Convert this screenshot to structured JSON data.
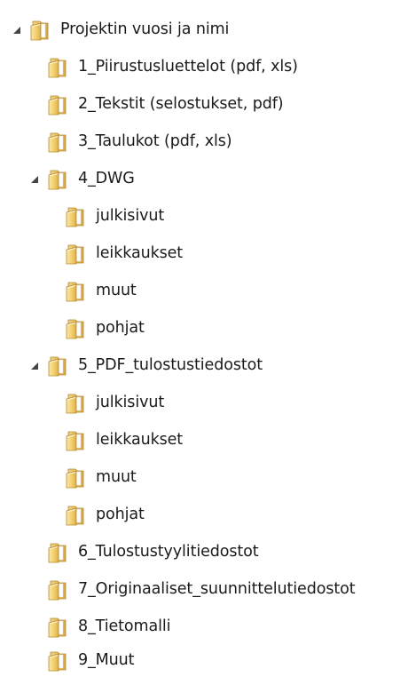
{
  "tree": {
    "root": {
      "label": "Projektin vuosi ja nimi",
      "icon": "folder-icon",
      "expanded": true
    },
    "level1": [
      {
        "label": "1_Piirustusluettelot (pdf, xls)",
        "icon": "folder-icon"
      },
      {
        "label": "2_Tekstit (selostukset, pdf)",
        "icon": "folder-icon"
      },
      {
        "label": "3_Taulukot (pdf, xls)",
        "icon": "folder-icon"
      },
      {
        "label": "4_DWG",
        "icon": "folder-icon",
        "expanded": true
      },
      {
        "label": "5_PDF_tulostustiedostot",
        "icon": "folder-icon",
        "expanded": true
      },
      {
        "label": "6_Tulostustyylitiedostot",
        "icon": "folder-icon"
      },
      {
        "label": "7_Originaaliset_suunnittelutiedostot",
        "icon": "folder-icon"
      },
      {
        "label": "8_Tietomalli",
        "icon": "folder-icon"
      },
      {
        "label": "9_Muut",
        "icon": "folder-icon"
      }
    ],
    "dwg_children": [
      {
        "label": "julkisivut",
        "icon": "folder-icon"
      },
      {
        "label": "leikkaukset",
        "icon": "folder-icon"
      },
      {
        "label": "muut",
        "icon": "folder-icon"
      },
      {
        "label": "pohjat",
        "icon": "folder-icon"
      }
    ],
    "pdf_children": [
      {
        "label": "julkisivut",
        "icon": "folder-icon"
      },
      {
        "label": "leikkaukset",
        "icon": "folder-icon"
      },
      {
        "label": "muut",
        "icon": "folder-icon"
      },
      {
        "label": "pohjat",
        "icon": "folder-icon"
      }
    ],
    "colors": {
      "folder_light": "#F7D98A",
      "folder_mid": "#E8B84A",
      "folder_dark": "#C9962E",
      "expander": "#444444"
    }
  }
}
